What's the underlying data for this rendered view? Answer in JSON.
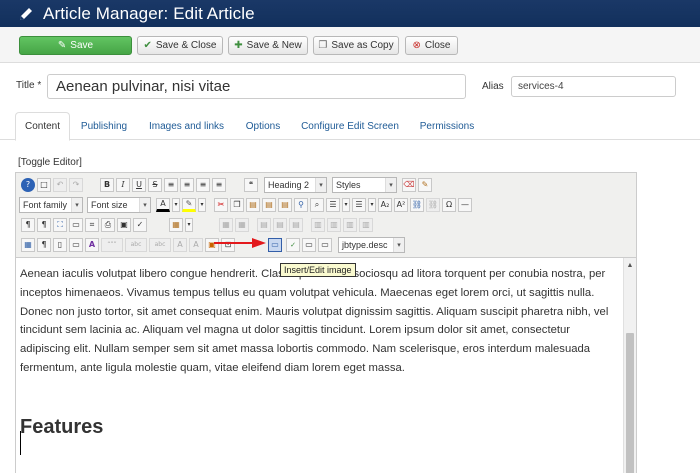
{
  "header": {
    "title": "Article Manager: Edit Article",
    "icon": "pencil-icon"
  },
  "toolbar": {
    "save": "Save",
    "save_close": "Save & Close",
    "save_new": "Save & New",
    "save_copy": "Save as Copy",
    "close": "Close"
  },
  "form": {
    "title_label": "Title",
    "required_mark": "*",
    "title_value": "Aenean pulvinar, nisi vitae",
    "alias_label": "Alias",
    "alias_value": "services-4"
  },
  "tabs": [
    "Content",
    "Publishing",
    "Images and links",
    "Options",
    "Configure Edit Screen",
    "Permissions"
  ],
  "active_tab": "Content",
  "toggle_editor": "[Toggle Editor]",
  "editor": {
    "selects": {
      "format": "Heading 2",
      "styles": "Styles",
      "font_family": "Font family",
      "font_size": "Font size",
      "class": "jbtype.desc"
    },
    "tooltip": "Insert/Edit image",
    "paragraph": "Aenean iaculis volutpat libero congue hendrerit. Class aptent taciti sociosqu ad litora torquent per conubia nostra, per inceptos himenaeos. Vivamus tempus tellus eu quam volutpat vehicula. Maecenas eget lorem orci, ut sagittis nulla. Donec non justo tortor, sit amet consequat enim. Mauris volutpat dignissim sagittis. Aliquam suscipit pharetra nibh, vel tincidunt sem lacinia ac. Aliquam vel magna ut dolor sagittis tincidunt. Lorem ipsum dolor sit amet, consectetur adipiscing elit. Nullam semper sem sit amet massa lobortis commodo. Nam scelerisque, eros interdum malesuada fermentum, ante ligula molestie quam, vitae eleifend diam lorem eget massa.",
    "heading": "Features"
  },
  "glyphs": {
    "bold": "B",
    "italic": "I",
    "underline": "U",
    "strike": "S",
    "text_color": "A",
    "omega": "Ω",
    "pilcrow": "¶",
    "superscript": "A²",
    "subscript": "A₂",
    "font_a": "A",
    "abc": "abc",
    "check": "✓",
    "chev": "▾",
    "up": "▲",
    "help": "?",
    "quote": "❝"
  },
  "colors": {
    "header_bg": "#1a3867",
    "save_green": "#46a546",
    "link": "#1f5b96",
    "arrow_red": "#e3191c"
  }
}
